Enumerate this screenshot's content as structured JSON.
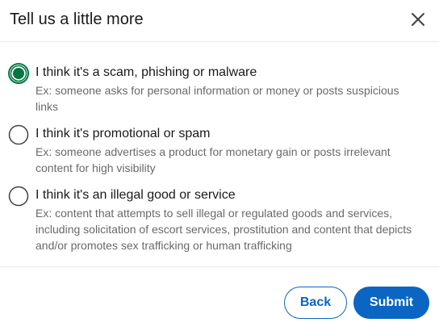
{
  "dialog": {
    "title": "Tell us a little more"
  },
  "options": [
    {
      "label": "I think it's a scam, phishing or malware",
      "description": "Ex: someone asks for personal information or money or posts suspicious links",
      "selected": true
    },
    {
      "label": "I think it's promotional or spam",
      "description": "Ex: someone advertises a product for monetary gain or posts irrelevant content for high visibility",
      "selected": false
    },
    {
      "label": "I think it's an illegal good or service",
      "description": "Ex: content that attempts to sell illegal or regulated goods and services, including solicitation of escort services, prostitution and content that depicts and/or promotes sex trafficking or human trafficking",
      "selected": false
    }
  ],
  "footer": {
    "back_label": "Back",
    "submit_label": "Submit"
  },
  "colors": {
    "accent": "#0a66c2",
    "selected_radio": "#057642"
  },
  "icons": {
    "close": "close-icon"
  }
}
